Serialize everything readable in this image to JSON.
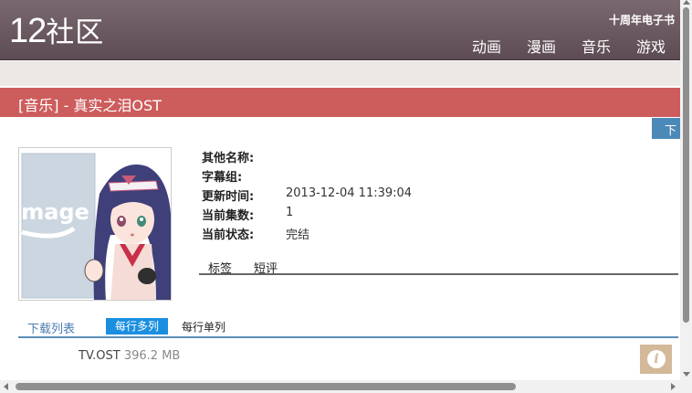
{
  "site": {
    "logo_num": "12",
    "logo_cn": "社区",
    "ebook_label": "十周年电子书"
  },
  "nav": [
    {
      "label": "动画"
    },
    {
      "label": "漫画"
    },
    {
      "label": "音乐"
    },
    {
      "label": "游戏"
    }
  ],
  "page": {
    "title": "[音乐] - 真实之泪OST",
    "download_button": "下"
  },
  "cover": {
    "placeholder_text": "image"
  },
  "info": [
    {
      "label": "其他名称:",
      "value": ""
    },
    {
      "label": "字幕组:",
      "value": ""
    },
    {
      "label": "更新时间:",
      "value": "2013-12-04 11:39:04"
    },
    {
      "label": "当前集数:",
      "value": "1"
    },
    {
      "label": "当前状态:",
      "value": "完结"
    }
  ],
  "tabs": [
    {
      "label": "标签"
    },
    {
      "label": "短评"
    }
  ],
  "download_list": {
    "title": "下载列表",
    "multi_label": "每行多列",
    "single_label": "每行单列"
  },
  "files": [
    {
      "name": "TV.OST",
      "size": "396.2 MB"
    }
  ],
  "colors": {
    "header": "#6e5c64",
    "title_bar": "#cd5c5c",
    "accent_blue": "#1a8fe0",
    "info_fab": "#d4b89a"
  },
  "icons": {
    "info_fab": "info-icon"
  }
}
